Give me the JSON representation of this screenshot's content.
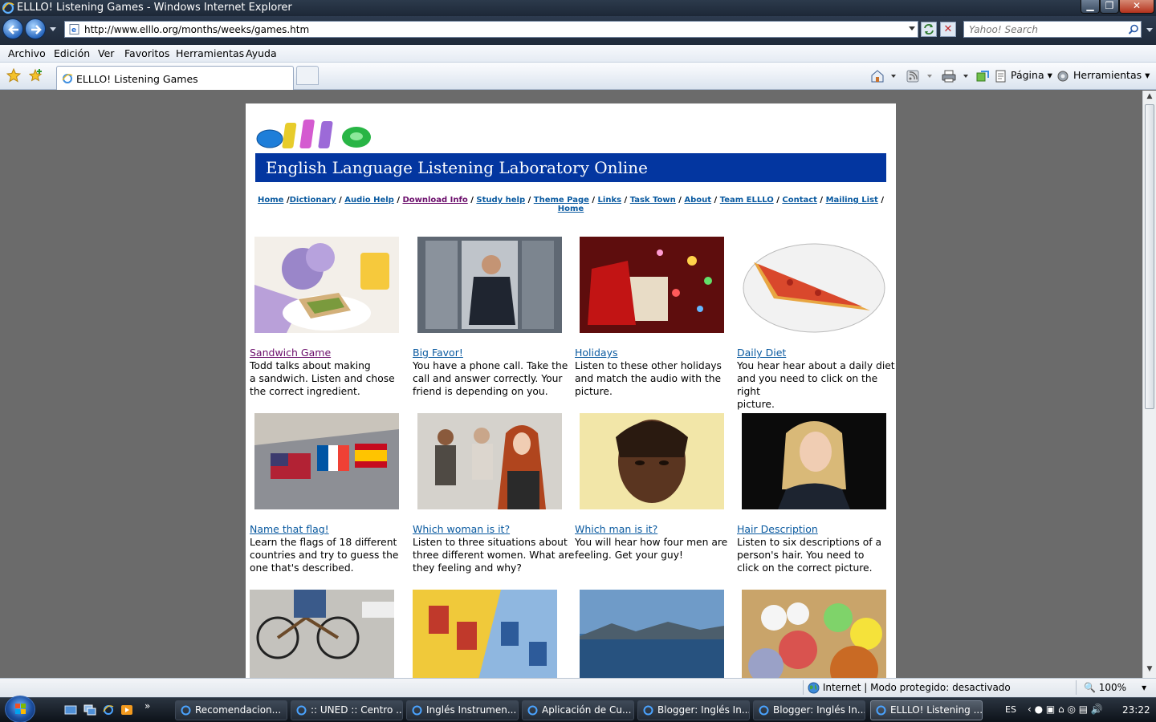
{
  "window": {
    "title": "ELLLO! Listening Games - Windows Internet Explorer"
  },
  "nav": {
    "url": "http://www.elllo.org/months/weeks/games.htm",
    "search_placeholder": "Yahoo! Search"
  },
  "menu": [
    "Archivo",
    "Edición",
    "Ver",
    "Favoritos",
    "Herramientas",
    "Ayuda"
  ],
  "tab": {
    "label": "ELLLO! Listening Games"
  },
  "commandbar": {
    "page_label": "Página",
    "tools_label": "Herramientas"
  },
  "page": {
    "logo_text": "elllo",
    "banner": "English Language Listening Laboratory Online",
    "sitenav": [
      {
        "label": "Home",
        "sep": " /",
        "visited": false
      },
      {
        "label": "Dictionary",
        "sep": " / ",
        "visited": false
      },
      {
        "label": "Audio Help",
        "sep": " / ",
        "visited": false
      },
      {
        "label": "Download Info",
        "sep": " / ",
        "visited": true
      },
      {
        "label": "Study help",
        "sep": " / ",
        "visited": false
      },
      {
        "label": "Theme Page",
        "sep": " / ",
        "visited": false
      },
      {
        "label": "Links",
        "sep": " / ",
        "visited": false
      },
      {
        "label": "Task Town",
        "sep": " / ",
        "visited": false
      },
      {
        "label": "About",
        "sep": " / ",
        "visited": false
      },
      {
        "label": "Team ELLLO",
        "sep": " / ",
        "visited": false
      },
      {
        "label": "Contact",
        "sep": " / ",
        "visited": false
      },
      {
        "label": "Mailing List",
        "sep": " / ",
        "visited": false
      },
      {
        "label": "Home",
        "sep": "",
        "visited": false
      }
    ],
    "games": [
      {
        "title": "Sandwich Game",
        "desc_lines": [
          "Todd talks about making",
          "a sandwich. Listen and chose",
          "the correct ingredient."
        ],
        "visited": true
      },
      {
        "title": "Big Favor!",
        "desc_lines": [
          "You have a phone call. Take the",
          "call and answer correctly. Your",
          "friend is depending on you."
        ],
        "visited": false
      },
      {
        "title": "Holidays",
        "desc_lines": [
          "Listen to these other holidays",
          "and match the audio with the",
          "picture."
        ],
        "visited": false
      },
      {
        "title": "Daily Diet",
        "desc_lines": [
          "You hear hear about a daily diet",
          "and you need to click on the right",
          "picture."
        ],
        "visited": false
      },
      {
        "title": "Name that flag!",
        "desc_lines": [
          "Learn the flags of 18 different",
          "countries and try to guess the",
          "one that's described."
        ],
        "visited": false
      },
      {
        "title": "Which woman is it?",
        "desc_lines": [
          "Listen to three situations about",
          "three different women. What are",
          "they feeling and why?"
        ],
        "visited": false
      },
      {
        "title": "Which man is it?",
        "desc_lines": [
          "You will hear how four men are",
          "feeling. Get your guy!"
        ],
        "visited": false
      },
      {
        "title": "Hair Description",
        "desc_lines": [
          "Listen to six descriptions of a",
          "person's hair. You need to",
          "click on the correct picture."
        ],
        "visited": false
      }
    ]
  },
  "status": {
    "zone": "Internet | Modo protegido: desactivado",
    "zoom": "100%"
  },
  "taskbar": {
    "tasks": [
      {
        "label": "Recomendacion...",
        "active": false
      },
      {
        "label": ":: UNED :: Centro ...",
        "active": false
      },
      {
        "label": "Inglés Instrumen...",
        "active": false
      },
      {
        "label": "Aplicación de Cu...",
        "active": false
      },
      {
        "label": "Blogger: Inglés In...",
        "active": false
      },
      {
        "label": "Blogger: Inglés In...",
        "active": false
      },
      {
        "label": "ELLLO! Listening ...",
        "active": true
      }
    ],
    "lang": "ES",
    "clock": "23:22"
  },
  "colors": {
    "banner": "#0336a0",
    "link": "#0a5aa0",
    "visited": "#6b0d6b"
  }
}
